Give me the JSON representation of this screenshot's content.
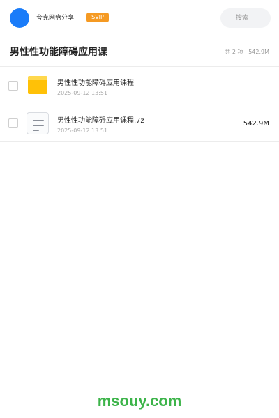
{
  "header": {
    "username": "夸克网盘分享",
    "badge": "SVIP",
    "search_placeholder": "搜索",
    "avatar_color": "#1a7cf9",
    "badge_color": "#f59a23"
  },
  "folder": {
    "title": "男性性功能障碍应用课",
    "summary": "共 2 项 · 542.9M"
  },
  "files": [
    {
      "icon": "folder-icon",
      "name": "男性性功能障碍应用课程",
      "date": "2025-09-12 13:51",
      "size": ""
    },
    {
      "icon": "archive-file-icon",
      "name": "男性性功能障碍应用课程.7z",
      "date": "2025-09-12 13:51",
      "size": "542.9M"
    }
  ],
  "footer": {
    "watermark": "msouy.com",
    "watermark_color": "#3db44a"
  }
}
